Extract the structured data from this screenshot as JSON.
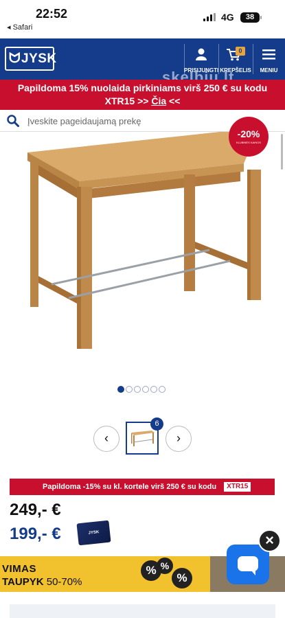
{
  "status_bar": {
    "time": "22:52",
    "back_app": "◂ Safari",
    "network": "4G",
    "battery": "38"
  },
  "header": {
    "logo_text": "JYSK",
    "watermark": "skelbiu.lt",
    "login_label": "PRISIJUNGTI",
    "cart_label": "KREPŠELIS",
    "cart_count": "0",
    "menu_label": "MENIU"
  },
  "promo": {
    "line1": "Papildoma 15% nuolaida pirkiniams virš 250 € su kodu",
    "code": "XTR15",
    "arrows_left": ">>",
    "link": "Čia",
    "arrows_right": "<<"
  },
  "search": {
    "placeholder": "Įveskite pageidaujamą prekę"
  },
  "product": {
    "sale_badge": "-20%",
    "sale_badge_sub": "KLUBINĖS KAINOS",
    "image_count": 6,
    "active_image": 1,
    "thumb_badge": "6"
  },
  "pricing": {
    "extra_discount": "Papildoma -15% su kl. kortele virš 250 € su kodu",
    "extra_code": "XTR15",
    "old_price": "249,- €",
    "new_price": "199,- €",
    "card_label": "JYSK"
  },
  "banner": {
    "line1": "VIMAS",
    "line2_bold": "TAUPYK",
    "line2_range": "50-70%",
    "percent_symbol": "%"
  },
  "colors": {
    "brand_blue": "#143c8a",
    "promo_red": "#c8102e",
    "banner_yellow": "#f2c12e",
    "chat_blue": "#1a73e8"
  }
}
